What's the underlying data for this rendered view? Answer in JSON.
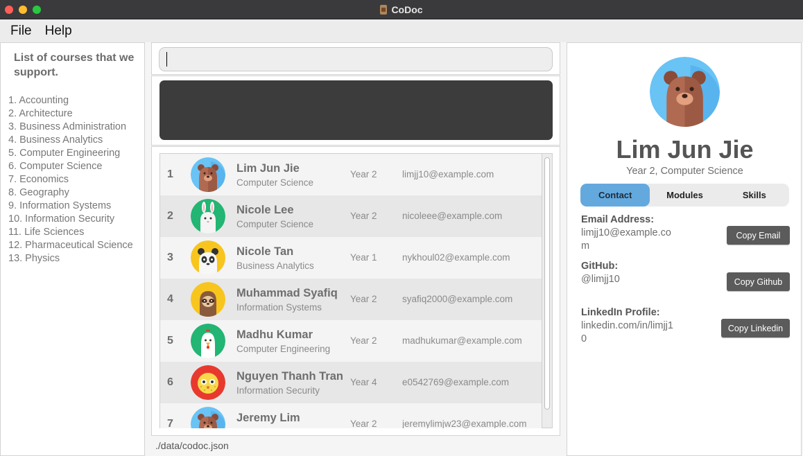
{
  "window": {
    "title": "CoDoc"
  },
  "menu": {
    "file": "File",
    "help": "Help"
  },
  "courses": {
    "title": "List of courses that we support.",
    "items": [
      "1. Accounting",
      "2. Architecture",
      "3. Business Administration",
      "4. Business Analytics",
      "5. Computer Engineering",
      "6. Computer Science",
      "7. Economics",
      "8. Geography",
      "9. Information Systems",
      "10. Information Security",
      "11. Life Sciences",
      "12. Pharmaceutical Science",
      "13. Physics"
    ]
  },
  "command": {
    "value": "",
    "placeholder": ""
  },
  "result": {
    "text": ""
  },
  "people": [
    {
      "index": "1",
      "name": "Lim Jun Jie",
      "course": "Computer Science",
      "year": "Year 2",
      "email": "limjj10@example.com",
      "avatar": "bear-icon",
      "avatar_bg": "#69c3f5"
    },
    {
      "index": "2",
      "name": "Nicole Lee",
      "course": "Computer Science",
      "year": "Year 2",
      "email": "nicoleee@example.com",
      "avatar": "rabbit-icon",
      "avatar_bg": "#22b573"
    },
    {
      "index": "3",
      "name": "Nicole Tan",
      "course": "Business Analytics",
      "year": "Year 1",
      "email": "nykhoul02@example.com",
      "avatar": "panda-icon",
      "avatar_bg": "#f7c51e"
    },
    {
      "index": "4",
      "name": "Muhammad Syafiq",
      "course": "Information Systems",
      "year": "Year 2",
      "email": "syafiq2000@example.com",
      "avatar": "sloth-icon",
      "avatar_bg": "#f7c51e"
    },
    {
      "index": "5",
      "name": "Madhu Kumar",
      "course": "Computer Engineering",
      "year": "Year 2",
      "email": "madhukumar@example.com",
      "avatar": "chicken-icon",
      "avatar_bg": "#22b573"
    },
    {
      "index": "6",
      "name": "Nguyen Thanh Tran",
      "course": "Information Security",
      "year": "Year 4",
      "email": "e0542769@example.com",
      "avatar": "pufferfish-icon",
      "avatar_bg": "#e8392e"
    },
    {
      "index": "7",
      "name": "Jeremy Lim",
      "course": "",
      "year": "Year 2",
      "email": "jeremylimjw23@example.com",
      "avatar": "bear-icon",
      "avatar_bg": "#69c3f5"
    }
  ],
  "status": {
    "path": "./data/codoc.json"
  },
  "profile": {
    "name": "Lim Jun Jie",
    "subtitle": "Year 2, Computer Science",
    "avatar": "bear-icon",
    "avatar_bg": "#69c3f5",
    "tabs": [
      "Contact",
      "Modules",
      "Skills"
    ],
    "active_tab": "Contact",
    "email_label": "Email Address:",
    "email": "limjj10@example.com",
    "github_label": "GitHub:",
    "github": "@limjj10",
    "linkedin_label": "LinkedIn Profile:",
    "linkedin": "linkedin.com/in/limjj10",
    "copy_email": "Copy Email",
    "copy_github": "Copy Github",
    "copy_linkedin": "Copy Linkedin"
  },
  "colors": {
    "accent_tab": "#64a9de",
    "button": "#5b5b5b",
    "result_box": "#3c3c3c"
  }
}
